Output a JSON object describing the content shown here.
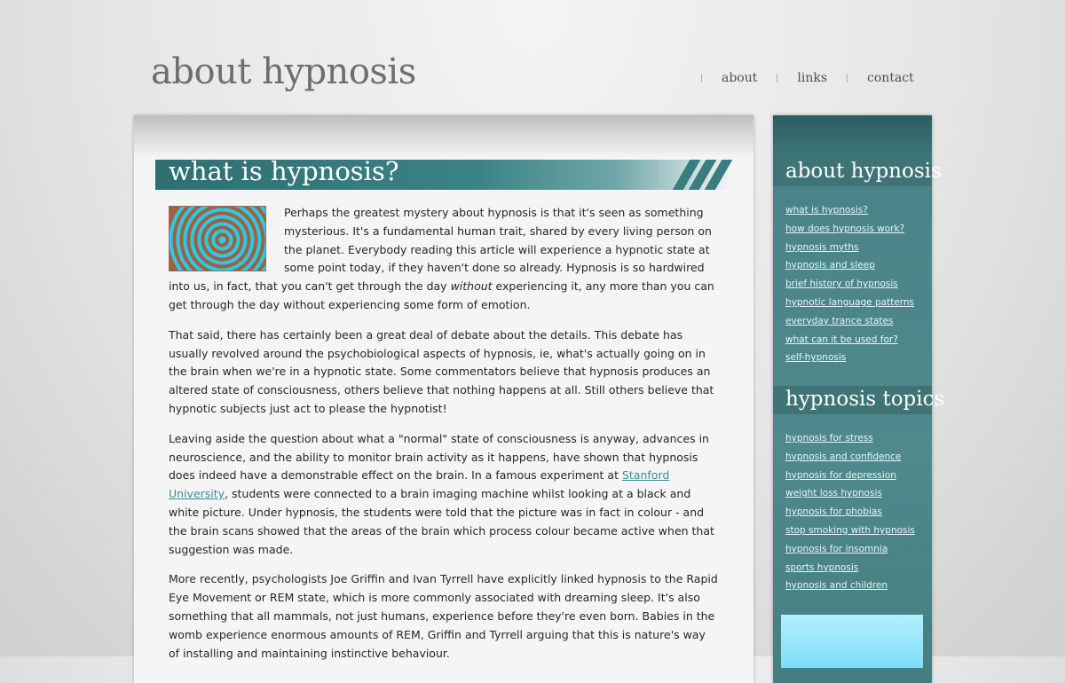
{
  "header": {
    "site_title": "about hypnosis",
    "nav": [
      "about",
      "links",
      "contact"
    ]
  },
  "article": {
    "title": "what is hypnosis?",
    "paragraphs": [
      {
        "before": "Perhaps the greatest mystery about hypnosis is that it's seen as something mysterious. It's a fundamental human trait, shared by every living person on the planet. Everybody reading this article will experience a hypnotic state at some point today, if they haven't done so already. Hypnosis is so hardwired into us, in fact, that you can't get through the day ",
        "em": "without",
        "after": " experiencing it, any more than you can get through the day without experiencing some form of emotion."
      },
      {
        "text": "That said, there has certainly been a great deal of debate about the details. This debate has usually revolved around the psychobiological aspects of hypnosis, ie, what's actually going on in the brain when we're in a hypnotic state. Some commentators believe that hypnosis produces an altered state of consciousness, others believe that nothing happens at all. Still others believe that hypnotic subjects just act to please the hypnotist!"
      },
      {
        "before": "Leaving aside the question about what a \"normal\" state of consciousness is anyway, advances in neuroscience, and the ability to monitor brain activity as it happens, have shown that hypnosis does indeed have a demonstrable effect on the brain. In a famous experiment at ",
        "link": "Stanford University",
        "after": ", students were connected to a brain imaging machine whilst looking at a black and white picture. Under hypnosis, the students were told that the picture was in fact in colour - and the brain scans showed that the areas of the brain which process colour became active when that suggestion was made."
      },
      {
        "text": "More recently, psychologists Joe Griffin and Ivan Tyrrell have explicitly linked hypnosis to the Rapid Eye Movement or REM state, which is more commonly associated with dreaming sleep. It's also something that all mammals, not just humans, experience before they're even born. Babies in the womb experience enormous amounts of REM, Griffin and Tyrrell arguing that this is nature's way of installing and maintaining instinctive behaviour."
      }
    ]
  },
  "sidebar": {
    "section1": {
      "heading": "about hypnosis",
      "links": [
        "what is hypnosis?",
        "how does hypnosis work?",
        "hypnosis myths",
        "hypnosis and sleep",
        "brief history of hypnosis",
        "hypnotic language patterns",
        "everyday trance states",
        "what can it be used for?",
        "self-hypnosis"
      ]
    },
    "section2": {
      "heading": "hypnosis topics",
      "links": [
        "hypnosis for stress",
        "hypnosis and confidence",
        "hypnosis for depression",
        "weight loss hypnosis",
        "hypnosis for phobias",
        "stop smoking with hypnosis",
        "hypnosis for insomnia",
        "sports hypnosis",
        "hypnosis and children"
      ]
    }
  },
  "colors": {
    "teal": "#3f7477",
    "link": "#3a8d93",
    "title_grey": "#6e6e6e"
  }
}
